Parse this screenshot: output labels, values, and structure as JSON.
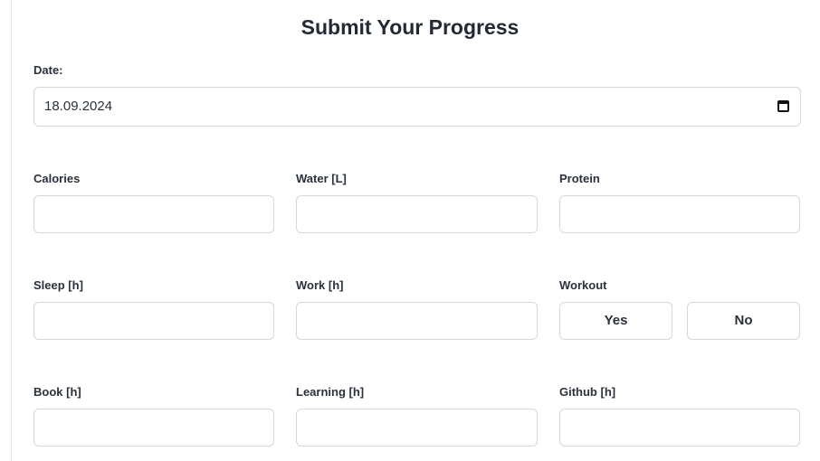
{
  "form": {
    "title": "Submit Your Progress",
    "date": {
      "label": "Date:",
      "value": "18.09.2024"
    },
    "fields": {
      "calories": {
        "label": "Calories",
        "value": ""
      },
      "water": {
        "label": "Water [L]",
        "value": ""
      },
      "protein": {
        "label": "Protein",
        "value": ""
      },
      "sleep": {
        "label": "Sleep [h]",
        "value": ""
      },
      "work": {
        "label": "Work [h]",
        "value": ""
      },
      "book": {
        "label": "Book [h]",
        "value": ""
      },
      "learning": {
        "label": "Learning [h]",
        "value": ""
      },
      "github": {
        "label": "Github [h]",
        "value": ""
      }
    },
    "workout": {
      "label": "Workout",
      "yes_label": "Yes",
      "no_label": "No"
    }
  },
  "icons": {
    "date_picker": "calendar-icon"
  },
  "colors": {
    "border": "#d4d7dd",
    "text": "#2b313c",
    "title": "#232a36"
  }
}
